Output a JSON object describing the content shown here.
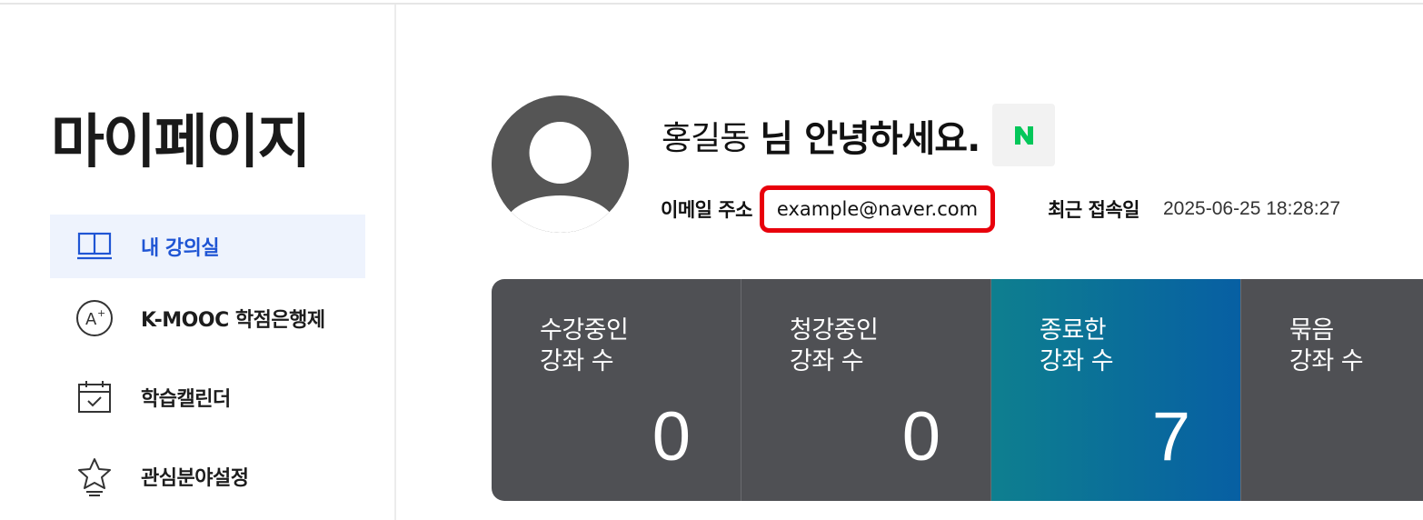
{
  "sidebar": {
    "title": "마이페이지",
    "items": [
      {
        "label": "내 강의실",
        "icon": "book-open-icon",
        "active": true
      },
      {
        "label": "K-MOOC 학점은행제",
        "icon": "a-plus-grade-icon",
        "active": false
      },
      {
        "label": "학습캘린더",
        "icon": "calendar-check-icon",
        "active": false
      },
      {
        "label": "관심분야설정",
        "icon": "star-badge-icon",
        "active": false
      }
    ]
  },
  "profile": {
    "avatar_icon": "user-avatar-icon",
    "name": "홍길동",
    "greeting": "님 안녕하세요.",
    "login_provider_icon": "naver-n-icon",
    "email_label": "이메일 주소",
    "email": "example@naver.com",
    "recent_login_label": "최근 접속일",
    "recent_login": "2025-06-25 18:28:27"
  },
  "stats": [
    {
      "label": "수강중인\n강좌 수",
      "value": "0",
      "highlight": false
    },
    {
      "label": "청강중인\n강좌 수",
      "value": "0",
      "highlight": false
    },
    {
      "label": "종료한\n강좌 수",
      "value": "7",
      "highlight": true
    },
    {
      "label": "묶음\n강좌 수",
      "value": "",
      "highlight": false
    }
  ],
  "colors": {
    "accent": "#1f55d4",
    "active_bg": "#eef3fd",
    "stat_card": "#4f5054",
    "highlight_start": "#0e7f8f",
    "highlight_end": "#075fa3",
    "email_outline": "#e8000b",
    "naver_green": "#03c75a"
  }
}
